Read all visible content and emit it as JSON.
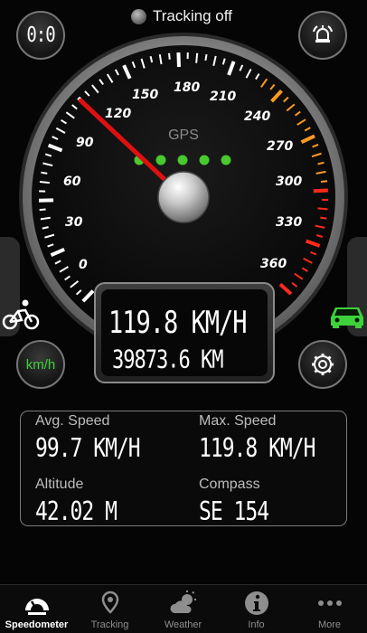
{
  "status": {
    "text": "Tracking off"
  },
  "buttons": {
    "reset_label": "0:0",
    "unit_label": "km/h"
  },
  "gauge": {
    "label": "GPS",
    "max": 360,
    "needle_value": 119.8,
    "gps_dots": 5,
    "tick_labels": [
      "0",
      "30",
      "60",
      "90",
      "120",
      "150",
      "180",
      "210",
      "240",
      "270",
      "300",
      "330",
      "360"
    ],
    "colors": {
      "normal": "#ffffff",
      "warn": "#ff9a1f",
      "danger": "#ff2a1a",
      "needle": "#e01010",
      "gps_dot": "#49c92e"
    }
  },
  "readout": {
    "speed": "119.8 KM/H",
    "distance": "39873.6 KM"
  },
  "stats": {
    "avg_speed": {
      "label": "Avg. Speed",
      "value": "99.7 KM/H"
    },
    "max_speed": {
      "label": "Max. Speed",
      "value": "119.8 KM/H"
    },
    "altitude": {
      "label": "Altitude",
      "value": "42.02 M"
    },
    "compass": {
      "label": "Compass",
      "value": "SE 154"
    }
  },
  "tabs": [
    {
      "label": "Speedometer",
      "icon": "speedometer-icon",
      "active": true
    },
    {
      "label": "Tracking",
      "icon": "location-pin-icon",
      "active": false
    },
    {
      "label": "Weather",
      "icon": "weather-icon",
      "active": false
    },
    {
      "label": "Info",
      "icon": "info-icon",
      "active": false
    },
    {
      "label": "More",
      "icon": "more-icon",
      "active": false
    }
  ],
  "accent": {
    "green": "#3ed23a"
  }
}
